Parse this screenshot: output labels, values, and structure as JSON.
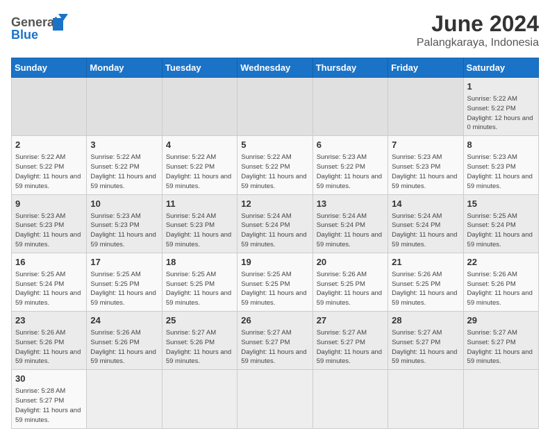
{
  "header": {
    "title": "June 2024",
    "location": "Palangkaraya, Indonesia",
    "logo_general": "General",
    "logo_blue": "Blue"
  },
  "days_of_week": [
    "Sunday",
    "Monday",
    "Tuesday",
    "Wednesday",
    "Thursday",
    "Friday",
    "Saturday"
  ],
  "weeks": [
    {
      "row_class": "row-odd",
      "days": [
        {
          "date": "",
          "empty": true
        },
        {
          "date": "",
          "empty": true
        },
        {
          "date": "",
          "empty": true
        },
        {
          "date": "",
          "empty": true
        },
        {
          "date": "",
          "empty": true
        },
        {
          "date": "",
          "empty": true
        },
        {
          "date": "1",
          "sunrise": "5:22 AM",
          "sunset": "5:22 PM",
          "daylight": "12 hours and 0 minutes."
        }
      ]
    },
    {
      "row_class": "row-even",
      "days": [
        {
          "date": "2",
          "sunrise": "5:22 AM",
          "sunset": "5:22 PM",
          "daylight": "11 hours and 59 minutes."
        },
        {
          "date": "3",
          "sunrise": "5:22 AM",
          "sunset": "5:22 PM",
          "daylight": "11 hours and 59 minutes."
        },
        {
          "date": "4",
          "sunrise": "5:22 AM",
          "sunset": "5:22 PM",
          "daylight": "11 hours and 59 minutes."
        },
        {
          "date": "5",
          "sunrise": "5:22 AM",
          "sunset": "5:22 PM",
          "daylight": "11 hours and 59 minutes."
        },
        {
          "date": "6",
          "sunrise": "5:23 AM",
          "sunset": "5:22 PM",
          "daylight": "11 hours and 59 minutes."
        },
        {
          "date": "7",
          "sunrise": "5:23 AM",
          "sunset": "5:23 PM",
          "daylight": "11 hours and 59 minutes."
        },
        {
          "date": "8",
          "sunrise": "5:23 AM",
          "sunset": "5:23 PM",
          "daylight": "11 hours and 59 minutes."
        }
      ]
    },
    {
      "row_class": "row-odd",
      "days": [
        {
          "date": "9",
          "sunrise": "5:23 AM",
          "sunset": "5:23 PM",
          "daylight": "11 hours and 59 minutes."
        },
        {
          "date": "10",
          "sunrise": "5:23 AM",
          "sunset": "5:23 PM",
          "daylight": "11 hours and 59 minutes."
        },
        {
          "date": "11",
          "sunrise": "5:24 AM",
          "sunset": "5:23 PM",
          "daylight": "11 hours and 59 minutes."
        },
        {
          "date": "12",
          "sunrise": "5:24 AM",
          "sunset": "5:24 PM",
          "daylight": "11 hours and 59 minutes."
        },
        {
          "date": "13",
          "sunrise": "5:24 AM",
          "sunset": "5:24 PM",
          "daylight": "11 hours and 59 minutes."
        },
        {
          "date": "14",
          "sunrise": "5:24 AM",
          "sunset": "5:24 PM",
          "daylight": "11 hours and 59 minutes."
        },
        {
          "date": "15",
          "sunrise": "5:25 AM",
          "sunset": "5:24 PM",
          "daylight": "11 hours and 59 minutes."
        }
      ]
    },
    {
      "row_class": "row-even",
      "days": [
        {
          "date": "16",
          "sunrise": "5:25 AM",
          "sunset": "5:24 PM",
          "daylight": "11 hours and 59 minutes."
        },
        {
          "date": "17",
          "sunrise": "5:25 AM",
          "sunset": "5:25 PM",
          "daylight": "11 hours and 59 minutes."
        },
        {
          "date": "18",
          "sunrise": "5:25 AM",
          "sunset": "5:25 PM",
          "daylight": "11 hours and 59 minutes."
        },
        {
          "date": "19",
          "sunrise": "5:25 AM",
          "sunset": "5:25 PM",
          "daylight": "11 hours and 59 minutes."
        },
        {
          "date": "20",
          "sunrise": "5:26 AM",
          "sunset": "5:25 PM",
          "daylight": "11 hours and 59 minutes."
        },
        {
          "date": "21",
          "sunrise": "5:26 AM",
          "sunset": "5:25 PM",
          "daylight": "11 hours and 59 minutes."
        },
        {
          "date": "22",
          "sunrise": "5:26 AM",
          "sunset": "5:26 PM",
          "daylight": "11 hours and 59 minutes."
        }
      ]
    },
    {
      "row_class": "row-odd",
      "days": [
        {
          "date": "23",
          "sunrise": "5:26 AM",
          "sunset": "5:26 PM",
          "daylight": "11 hours and 59 minutes."
        },
        {
          "date": "24",
          "sunrise": "5:26 AM",
          "sunset": "5:26 PM",
          "daylight": "11 hours and 59 minutes."
        },
        {
          "date": "25",
          "sunrise": "5:27 AM",
          "sunset": "5:26 PM",
          "daylight": "11 hours and 59 minutes."
        },
        {
          "date": "26",
          "sunrise": "5:27 AM",
          "sunset": "5:27 PM",
          "daylight": "11 hours and 59 minutes."
        },
        {
          "date": "27",
          "sunrise": "5:27 AM",
          "sunset": "5:27 PM",
          "daylight": "11 hours and 59 minutes."
        },
        {
          "date": "28",
          "sunrise": "5:27 AM",
          "sunset": "5:27 PM",
          "daylight": "11 hours and 59 minutes."
        },
        {
          "date": "29",
          "sunrise": "5:27 AM",
          "sunset": "5:27 PM",
          "daylight": "11 hours and 59 minutes."
        }
      ]
    },
    {
      "row_class": "row-even",
      "days": [
        {
          "date": "30",
          "sunrise": "5:28 AM",
          "sunset": "5:27 PM",
          "daylight": "11 hours and 59 minutes."
        },
        {
          "date": "",
          "empty": true
        },
        {
          "date": "",
          "empty": true
        },
        {
          "date": "",
          "empty": true
        },
        {
          "date": "",
          "empty": true
        },
        {
          "date": "",
          "empty": true
        },
        {
          "date": "",
          "empty": true
        }
      ]
    }
  ]
}
